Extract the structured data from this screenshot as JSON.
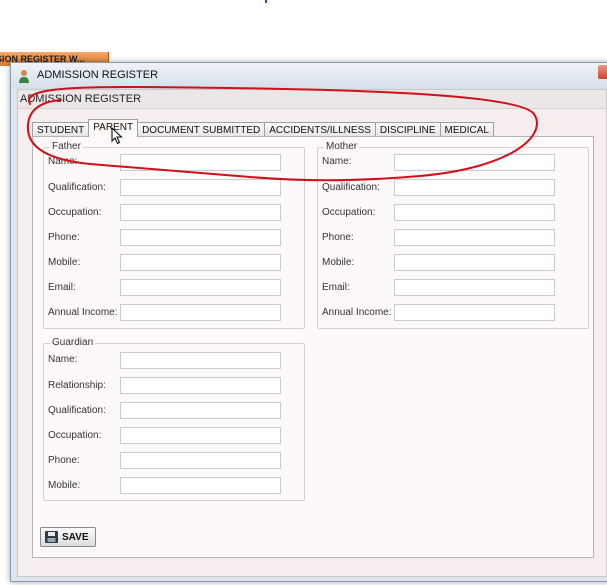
{
  "taskbar": {
    "tab_label": "SION REGISTER W..."
  },
  "window": {
    "title": "ADMISSION REGISTER"
  },
  "form": {
    "strip_title": "ADMISSION REGISTER"
  },
  "tabs": [
    {
      "label": "STUDENT"
    },
    {
      "label": "PARENT",
      "active": true
    },
    {
      "label": "DOCUMENT SUBMITTED"
    },
    {
      "label": "ACCIDENTS/ILLNESS"
    },
    {
      "label": "DISCIPLINE"
    },
    {
      "label": "MEDICAL"
    }
  ],
  "father": {
    "legend": "Father",
    "labels": {
      "name": "Name:",
      "qualification": "Qualification:",
      "occupation": "Occupation:",
      "phone": "Phone:",
      "mobile": "Mobile:",
      "email": "Email:",
      "annual_income": "Annual Income:"
    },
    "values": {
      "name": "",
      "qualification": "",
      "occupation": "",
      "phone": "",
      "mobile": "",
      "email": "",
      "annual_income": ""
    }
  },
  "mother": {
    "legend": "Mother",
    "labels": {
      "name": "Name:",
      "qualification": "Qualification:",
      "occupation": "Occupation:",
      "phone": "Phone:",
      "mobile": "Mobile:",
      "email": "Email:",
      "annual_income": "Annual Income:"
    },
    "values": {
      "name": "",
      "qualification": "",
      "occupation": "",
      "phone": "",
      "mobile": "",
      "email": "",
      "annual_income": ""
    }
  },
  "guardian": {
    "legend": "Guardian",
    "labels": {
      "name": "Name:",
      "relationship": "Relationship:",
      "qualification": "Qualification:",
      "occupation": "Occupation:",
      "phone": "Phone:",
      "mobile": "Mobile:"
    },
    "values": {
      "name": "",
      "relationship": "",
      "qualification": "",
      "occupation": "",
      "phone": "",
      "mobile": ""
    }
  },
  "save": {
    "label": "SAVE",
    "icon": "floppy-disk-icon"
  },
  "colors": {
    "annotation": "#d0101a",
    "taskbar": "#e9843a"
  }
}
